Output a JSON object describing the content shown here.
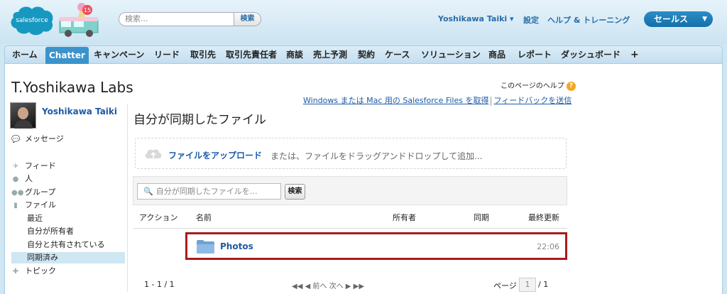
{
  "header": {
    "logo_text": "salesforce",
    "truck_badge": "15",
    "search_placeholder": "検索...",
    "search_button": "検索",
    "user_menu": "Yoshikawa Taiki ▾",
    "settings": "設定",
    "help_training": "ヘルプ & トレーニング",
    "app_menu": "セールス"
  },
  "tabs": [
    "ホーム",
    "Chatter",
    "キャンペーン",
    "リード",
    "取引先",
    "取引先責任者",
    "商談",
    "売上予測",
    "契約",
    "ケース",
    "ソリューション",
    "商品",
    "レポート",
    "ダッシュボード",
    "+"
  ],
  "page": {
    "title": "T.Yoshikawa Labs",
    "help_link": "このページのヘルプ",
    "files_link": "Windows または Mac 用の Salesforce Files を取得",
    "feedback_link": "フィードバックを送信"
  },
  "sidebar": {
    "user_name": "Yoshikawa Taiki",
    "messages": "メッセージ",
    "feed": "フィード",
    "people": "人",
    "groups": "グループ",
    "files": "ファイル",
    "recent": "最近",
    "owned": "自分が所有者",
    "shared": "自分と共有されている",
    "synced": "同期済み",
    "topics": "トピック"
  },
  "content": {
    "section_title": "自分が同期したファイル",
    "upload_link": "ファイルをアップロード",
    "upload_rest": "または、ファイルをドラッグアンドドロップして追加...",
    "search_placeholder": "自分が同期したファイルを…",
    "search_button": "検索",
    "columns": {
      "action": "アクション",
      "name": "名前",
      "owner": "所有者",
      "sync": "同期",
      "modified": "最終更新"
    },
    "rows": [
      {
        "name": "Photos",
        "modified": "22:06"
      }
    ],
    "range": "1 - 1 / 1",
    "pager": "◀◀ ◀ 前へ  次へ ▶ ▶▶",
    "page_label": "ページ",
    "page_value": "1",
    "page_total": "/  1"
  },
  "colors": {
    "accent": "#3a93cc",
    "link": "#1d5aa6",
    "highlight_border": "#a81c1c",
    "sidebar_active": "#cfe6f3"
  },
  "icons": [
    "search-icon",
    "help-icon",
    "cloud-upload-icon",
    "folder-icon",
    "message-icon",
    "feed-icon",
    "people-icon",
    "group-icon",
    "file-icon",
    "topic-icon"
  ]
}
